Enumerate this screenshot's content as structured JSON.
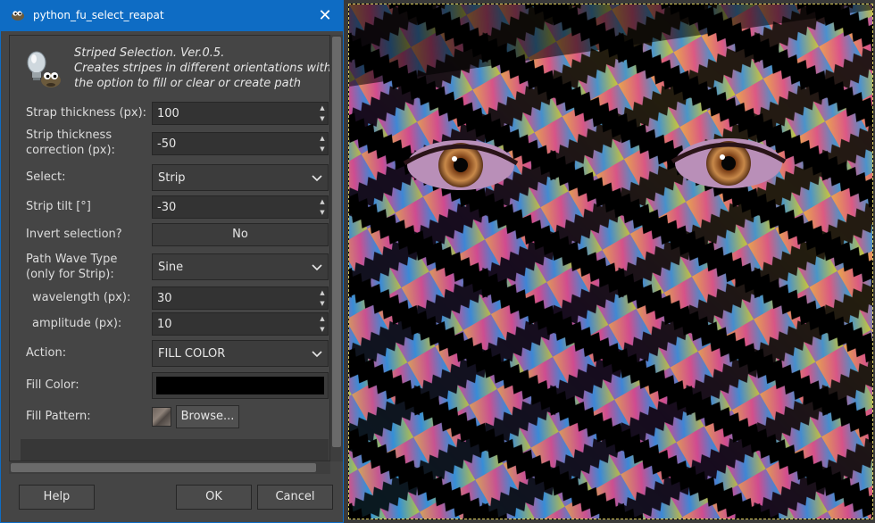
{
  "window": {
    "title": "python_fu_select_reapat",
    "close_glyph": "✕",
    "icon": "gimp-wilber-icon"
  },
  "plugin": {
    "icon": "gimp-plugin-icon",
    "description_lines": [
      "Striped Selection. Ver.0.5.",
      "Creates stripes in different orientations with",
      "the option to fill or clear or create path"
    ]
  },
  "fields": {
    "strap_thickness": {
      "label": "Strap thickness (px):",
      "value": "100"
    },
    "strip_correction": {
      "label_1": "Strip thickness",
      "label_2": "correction (px):",
      "value": "-50"
    },
    "select": {
      "label": "Select:",
      "value": "Strip"
    },
    "strip_tilt": {
      "label": "Strip tilt [°]",
      "value": "-30"
    },
    "invert": {
      "label": "Invert selection?",
      "value": "No"
    },
    "wave_type": {
      "label_1": "Path Wave Type",
      "label_2": "(only for Strip):",
      "value": "Sine"
    },
    "wavelength": {
      "label": "wavelength (px):",
      "value": "30"
    },
    "amplitude": {
      "label": "amplitude (px):",
      "value": "10"
    },
    "action": {
      "label": "Action:",
      "value": "FILL COLOR"
    },
    "fill_color": {
      "label": "Fill Color:",
      "value": "#000000"
    },
    "fill_pattern": {
      "label": "Fill Pattern:",
      "browse_label": "Browse..."
    }
  },
  "buttons": {
    "help": "Help",
    "ok": "OK",
    "cancel": "Cancel"
  },
  "canvas": {
    "description": "image-canvas-striped-face",
    "selection_border_color": "#d6c85a"
  }
}
